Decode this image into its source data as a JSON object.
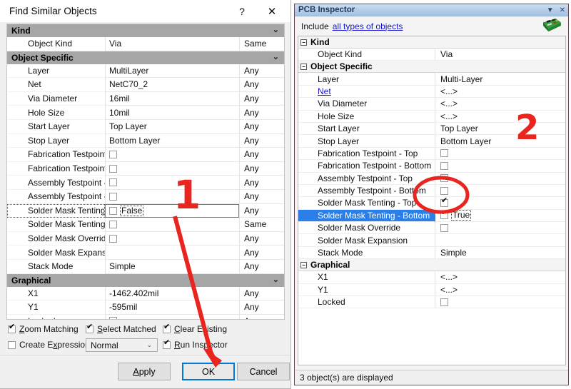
{
  "find_dialog": {
    "title": "Find Similar Objects",
    "help_icon": "?",
    "close_icon": "✕",
    "sections": [
      {
        "header": "Kind",
        "collapse_icon": "⌄",
        "rows": [
          {
            "name": "Object Kind",
            "value": "Via",
            "match": "Same",
            "type": "text"
          }
        ]
      },
      {
        "header": "Object Specific",
        "collapse_icon": "⌄",
        "rows": [
          {
            "name": "Layer",
            "value": "MultiLayer",
            "match": "Any",
            "type": "text"
          },
          {
            "name": "Net",
            "value": "NetC70_2",
            "match": "Any",
            "type": "text"
          },
          {
            "name": "Via Diameter",
            "value": "16mil",
            "match": "Any",
            "type": "text"
          },
          {
            "name": "Hole Size",
            "value": "10mil",
            "match": "Any",
            "type": "text"
          },
          {
            "name": "Start Layer",
            "value": "Top Layer",
            "match": "Any",
            "type": "text"
          },
          {
            "name": "Stop Layer",
            "value": "Bottom Layer",
            "match": "Any",
            "type": "text"
          },
          {
            "name": "Fabrication Testpoint - T",
            "value": "",
            "match": "Any",
            "type": "checkbox",
            "checked": false
          },
          {
            "name": "Fabrication Testpoint - B",
            "value": "",
            "match": "Any",
            "type": "checkbox",
            "checked": false
          },
          {
            "name": "Assembly Testpoint - Top",
            "value": "",
            "match": "Any",
            "type": "checkbox",
            "checked": false
          },
          {
            "name": "Assembly Testpoint - Bot",
            "value": "",
            "match": "Any",
            "type": "checkbox",
            "checked": false
          },
          {
            "name": "Solder Mask Tenting - T",
            "value": "False",
            "match": "Any",
            "type": "checkbox-edit",
            "checked": false,
            "editing": true
          },
          {
            "name": "Solder Mask Tenting - B",
            "value": "",
            "match": "Same",
            "type": "checkbox",
            "checked": false
          },
          {
            "name": "Solder Mask Override",
            "value": "",
            "match": "Any",
            "type": "checkbox",
            "checked": false
          },
          {
            "name": "Solder Mask Expansion",
            "value": "",
            "match": "Any",
            "type": "text"
          },
          {
            "name": "Stack Mode",
            "value": "Simple",
            "match": "Any",
            "type": "text"
          }
        ]
      },
      {
        "header": "Graphical",
        "collapse_icon": "⌄",
        "rows": [
          {
            "name": "X1",
            "value": "-1462.402mil",
            "match": "Any",
            "type": "text"
          },
          {
            "name": "Y1",
            "value": "-595mil",
            "match": "Any",
            "type": "text"
          },
          {
            "name": "Locked",
            "value": "",
            "match": "Any",
            "type": "checkbox",
            "checked": false
          }
        ]
      }
    ],
    "options": [
      {
        "label": "Zoom Matching",
        "accel": "Z",
        "checked": true
      },
      {
        "label": "Select Matched",
        "accel": "S",
        "checked": true
      },
      {
        "label": "Clear Existing",
        "accel": "C",
        "checked": true
      },
      {
        "label": "Create Expression",
        "accel": "x",
        "checked": false
      },
      {
        "label": "Run Inspector",
        "accel": "R",
        "checked": true
      }
    ],
    "mode_select": {
      "value": "Normal",
      "arrow": "⌄"
    },
    "buttons": {
      "apply": "Apply",
      "apply_accel": "A",
      "ok": "OK",
      "cancel": "Cancel"
    }
  },
  "pcb_inspector": {
    "title": "PCB Inspector",
    "titlebar_icons": {
      "menu": "▼",
      "close": "✕"
    },
    "include_label": "Include",
    "include_link": "all types of objects",
    "board_icon": "pcb-board-icon",
    "sections": [
      {
        "header": "Kind",
        "collapse_icon": "−",
        "rows": [
          {
            "name": "Object Kind",
            "value": "Via",
            "type": "text"
          }
        ]
      },
      {
        "header": "Object Specific",
        "collapse_icon": "−",
        "rows": [
          {
            "name": "Layer",
            "value": "Multi-Layer",
            "type": "text"
          },
          {
            "name": "Net",
            "value": "<...>",
            "type": "link"
          },
          {
            "name": "Via Diameter",
            "value": "<...>",
            "type": "text"
          },
          {
            "name": "Hole Size",
            "value": "<...>",
            "type": "text"
          },
          {
            "name": "Start Layer",
            "value": "Top Layer",
            "type": "text"
          },
          {
            "name": "Stop Layer",
            "value": "Bottom Layer",
            "type": "text"
          },
          {
            "name": "Fabrication Testpoint - Top",
            "value": "",
            "type": "checkbox",
            "checked": false
          },
          {
            "name": "Fabrication Testpoint - Bottom",
            "value": "",
            "type": "checkbox",
            "checked": false
          },
          {
            "name": "Assembly Testpoint - Top",
            "value": "",
            "type": "checkbox",
            "checked": false
          },
          {
            "name": "Assembly Testpoint - Bottom",
            "value": "",
            "type": "checkbox",
            "checked": false
          },
          {
            "name": "Solder Mask Tenting - Top",
            "value": "",
            "type": "checkbox",
            "checked": true
          },
          {
            "name": "Solder Mask Tenting - Bottom",
            "value": "True",
            "type": "checkbox-edit",
            "checked": true,
            "selected": true
          },
          {
            "name": "Solder Mask Override",
            "value": "",
            "type": "checkbox",
            "checked": false
          },
          {
            "name": "Solder Mask Expansion",
            "value": "",
            "type": "text"
          },
          {
            "name": "Stack Mode",
            "value": "Simple",
            "type": "text"
          }
        ]
      },
      {
        "header": "Graphical",
        "collapse_icon": "−",
        "rows": [
          {
            "name": "X1",
            "value": "<...>",
            "type": "text"
          },
          {
            "name": "Y1",
            "value": "<...>",
            "type": "text"
          },
          {
            "name": "Locked",
            "value": "",
            "type": "checkbox",
            "checked": false
          }
        ]
      }
    ],
    "status": "3 object(s) are displayed"
  },
  "annotations": {
    "step_one": "1",
    "step_two": "2",
    "accent_color": "#e8251f"
  }
}
